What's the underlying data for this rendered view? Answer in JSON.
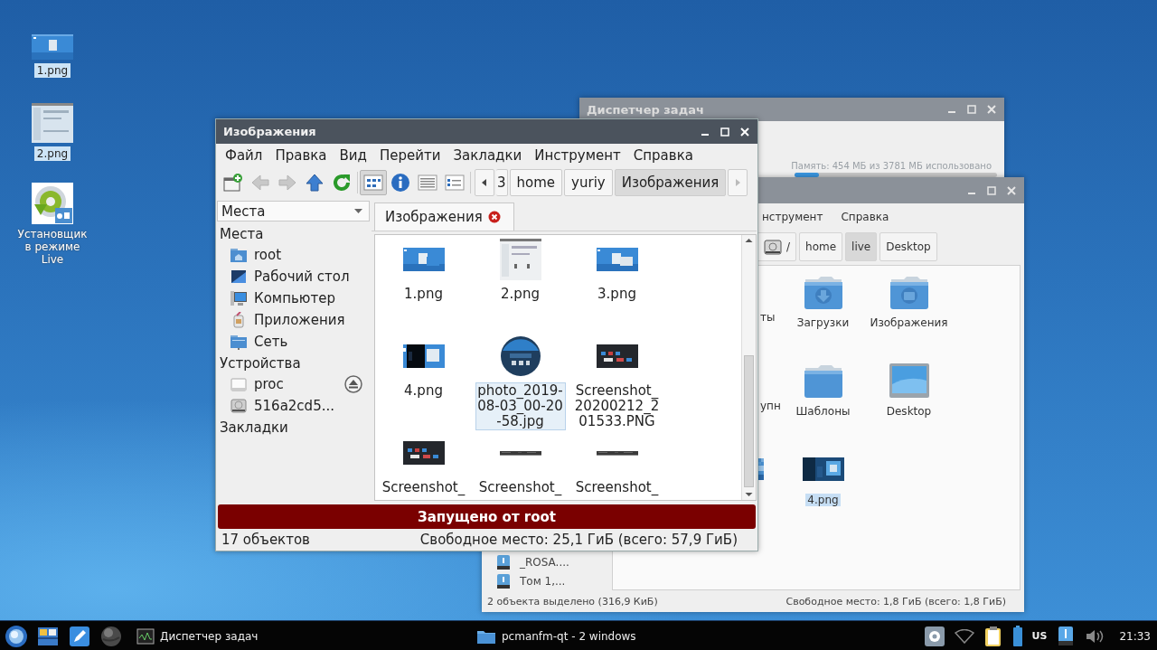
{
  "desktop_icons": [
    {
      "label": "1.png",
      "selected": true
    },
    {
      "label": "2.png",
      "selected": true
    },
    {
      "label": "Установщик в режиме Live",
      "selected": false
    }
  ],
  "task_manager": {
    "title": "Диспетчер задач",
    "memory_text": "Память: 454 МБ из 3781 МБ использовано",
    "memory": {
      "level": 0.12
    }
  },
  "back_window": {
    "menu": [
      "нструмент",
      "Справка"
    ],
    "path": [
      {
        "label": "/",
        "kind": "root",
        "selected": false
      },
      {
        "label": "home",
        "kind": "dir",
        "selected": false
      },
      {
        "label": "live",
        "kind": "dir",
        "selected": true
      },
      {
        "label": "Desktop",
        "kind": "dir",
        "selected": false
      }
    ],
    "places": [
      {
        "label": "_ROSA...."
      },
      {
        "label": "Том 1,..."
      }
    ],
    "rows": [
      [
        {
          "label": "ты",
          "kind": "partial",
          "selected": false
        },
        {
          "label": "Загрузки",
          "kind": "downloads",
          "selected": false
        },
        {
          "label": "Изображения",
          "kind": "pictures",
          "selected": false
        }
      ],
      [
        {
          "label": "упн",
          "kind": "partial",
          "selected": false
        },
        {
          "label": "Шаблоны",
          "kind": "folder",
          "selected": false
        },
        {
          "label": "Desktop",
          "kind": "desktop",
          "selected": false
        }
      ],
      [
        {
          "kind": "partial-icon",
          "selected": false
        },
        {
          "label": "4.png",
          "selected": true
        }
      ]
    ],
    "status_left": "2 объекта выделено (316,9 КиБ)",
    "status_right": "Свободное место: 1,8 ГиБ (всего: 1,8 ГиБ)"
  },
  "main_window": {
    "title": "Изображения",
    "menu": [
      "Файл",
      "Правка",
      "Вид",
      "Перейти",
      "Закладки",
      "Инструмент",
      "Справка"
    ],
    "nav_buttons": [
      {
        "kind": "new-tab",
        "disabled": false
      },
      {
        "kind": "back",
        "disabled": true
      },
      {
        "kind": "forward",
        "disabled": true
      },
      {
        "kind": "up",
        "disabled": false
      },
      {
        "kind": "reload",
        "disabled": false
      }
    ],
    "view_buttons": [
      {
        "kind": "icons",
        "selected": true
      },
      {
        "kind": "info",
        "selected": false
      },
      {
        "kind": "details",
        "selected": false
      },
      {
        "kind": "compact",
        "selected": false
      }
    ],
    "path": [
      {
        "label": "3",
        "selected": false
      },
      {
        "label": "home",
        "selected": false
      },
      {
        "label": "yuriy",
        "selected": false
      },
      {
        "label": "Изображения",
        "selected": true
      }
    ],
    "places_combo": "Места",
    "sidebar": [
      {
        "title": "Места",
        "children": [
          {
            "label": "root",
            "kind": "home",
            "eject": false
          },
          {
            "label": "Рабочий стол",
            "kind": "desktop",
            "eject": false
          },
          {
            "label": "Компьютер",
            "kind": "computer",
            "eject": false
          },
          {
            "label": "Приложения",
            "kind": "apps",
            "eject": false
          },
          {
            "label": "Сеть",
            "kind": "network",
            "eject": false
          }
        ]
      },
      {
        "title": "Устройства",
        "children": [
          {
            "label": "proc",
            "kind": "drive",
            "eject": true
          },
          {
            "label": "516a2cd5...",
            "kind": "hdd",
            "eject": false
          }
        ]
      },
      {
        "title": "Закладки"
      }
    ],
    "tab": {
      "label": "Изображения",
      "closable": true
    },
    "files": [
      {
        "label": "1.png",
        "selected": false
      },
      {
        "label": "2.png",
        "selected": false
      },
      {
        "label": "3.png",
        "selected": false
      },
      {
        "label": "4.png",
        "selected": false
      },
      {
        "label": "photo_2019-08-03_00-20-58.jpg",
        "selected": true
      },
      {
        "label": "Screenshot_20200212_201533.PNG",
        "selected": false
      },
      {
        "label": "Screenshot_",
        "selected": false
      },
      {
        "label": "Screenshot_",
        "selected": false
      },
      {
        "label": "Screenshot_",
        "selected": false
      }
    ],
    "banner": "Запущено от root",
    "status_left": "17 объектов",
    "status_right": "Свободное место: 25,1 ГиБ (всего: 57,9 ГиБ)"
  },
  "taskbar": {
    "launchers": [
      {
        "kind": "start"
      },
      {
        "kind": "files"
      },
      {
        "kind": "editor"
      },
      {
        "kind": "globe"
      }
    ],
    "tasks": [
      {
        "label": "Диспетчер задач",
        "kind": "monitor",
        "selected": false
      },
      {
        "label": "pcmanfm-qt - 2 windows",
        "kind": "folder",
        "selected": false
      }
    ],
    "tray": [
      {
        "kind": "settings"
      },
      {
        "kind": "wifi"
      },
      {
        "kind": "clipboard"
      },
      {
        "kind": "battery"
      },
      {
        "kind": "text",
        "label": "US"
      },
      {
        "kind": "usb"
      },
      {
        "kind": "volume"
      }
    ],
    "clock": "21:33"
  }
}
